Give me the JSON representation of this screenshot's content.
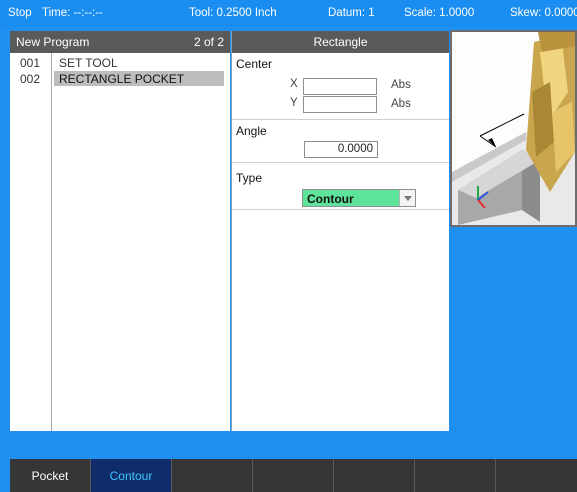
{
  "status_bar": {
    "stop": "Stop",
    "time": "Time: --:--:--",
    "tool": "Tool: 0.2500 Inch",
    "datum": "Datum: 1",
    "scale": "Scale: 1.0000",
    "skew": "Skew: 0.0000"
  },
  "program_panel": {
    "title": "New Program",
    "page": "2 of 2",
    "steps": [
      {
        "num": "001",
        "name": "SET TOOL"
      },
      {
        "num": "002",
        "name": "RECTANGLE POCKET"
      }
    ]
  },
  "form": {
    "title": "Rectangle",
    "center": {
      "label": "Center",
      "x_axis": "X",
      "x_value": "",
      "x_unit": "Abs",
      "y_axis": "Y",
      "y_value": "",
      "y_unit": "Abs"
    },
    "angle": {
      "label": "Angle",
      "value": "0.0000"
    },
    "type": {
      "label": "Type",
      "value": "Contour"
    }
  },
  "softkeys": [
    {
      "label": "Pocket"
    },
    {
      "label": "Contour"
    },
    {
      "label": ""
    },
    {
      "label": ""
    },
    {
      "label": ""
    },
    {
      "label": ""
    },
    {
      "label": ""
    }
  ],
  "colors": {
    "background": "#1f8ff0",
    "type_dropdown": "#5ee39a",
    "softkey_active": "#0e2d6a",
    "softkey_active_text": "#3ec6ff"
  }
}
